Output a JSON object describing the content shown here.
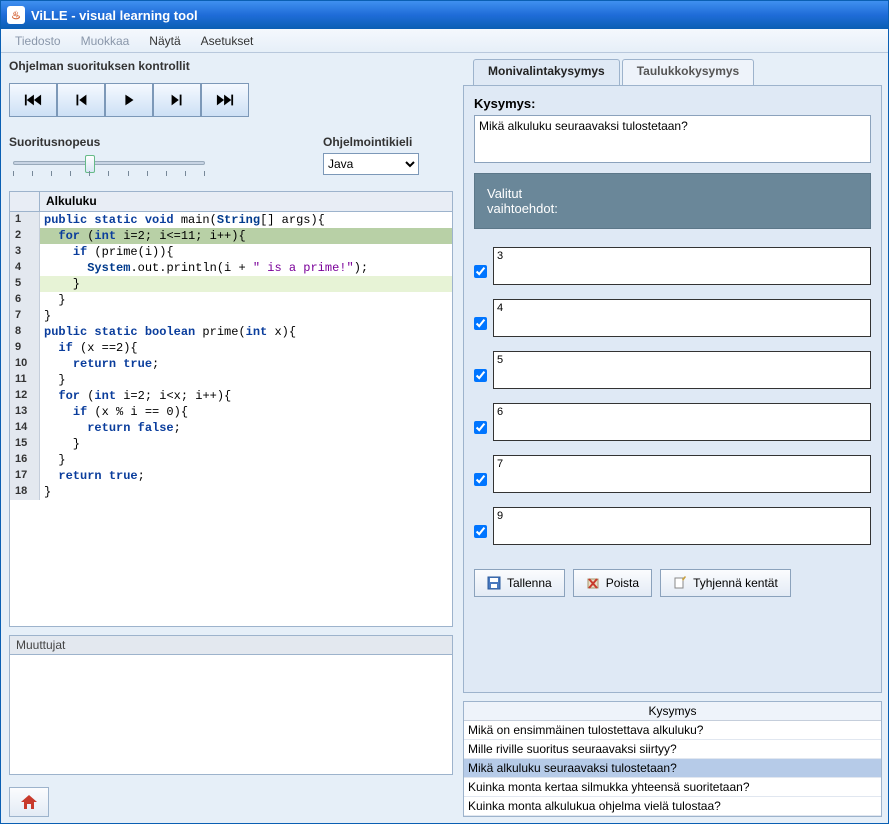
{
  "window": {
    "title": "ViLLE - visual learning tool"
  },
  "menu": {
    "tiedosto": "Tiedosto",
    "muokkaa": "Muokkaa",
    "nayta": "Näytä",
    "asetukset": "Asetukset"
  },
  "controls": {
    "title": "Ohjelman suorituksen kontrollit",
    "speed_label": "Suoritusnopeus",
    "lang_label": "Ohjelmointikieli",
    "lang_selected": "Java"
  },
  "code": {
    "title": "Alkuluku",
    "lines": [
      {
        "n": 1,
        "hl": "",
        "html": "<span class='kw-blue'>public static void</span> main(<span class='kw-class'>String</span>[] args){"
      },
      {
        "n": 2,
        "hl": "hl-green",
        "html": "  <span class='kw-blue'>for</span> (<span class='kw-blue'>int</span> i=2; i&lt;=11; i++){"
      },
      {
        "n": 3,
        "hl": "",
        "html": "    <span class='kw-blue'>if</span> (prime(i)){"
      },
      {
        "n": 4,
        "hl": "",
        "html": "      <span class='kw-class'>System</span>.out.println(i + <span class='kw-str'>\" is a prime!\"</span>);"
      },
      {
        "n": 5,
        "hl": "hl-light",
        "html": "    }"
      },
      {
        "n": 6,
        "hl": "",
        "html": "  }"
      },
      {
        "n": 7,
        "hl": "",
        "html": "}"
      },
      {
        "n": 8,
        "hl": "",
        "html": "<span class='kw-blue'>public static boolean</span> prime(<span class='kw-blue'>int</span> x){"
      },
      {
        "n": 9,
        "hl": "",
        "html": "  <span class='kw-blue'>if</span> (x ==2){"
      },
      {
        "n": 10,
        "hl": "",
        "html": "    <span class='kw-blue'>return true</span>;"
      },
      {
        "n": 11,
        "hl": "",
        "html": "  }"
      },
      {
        "n": 12,
        "hl": "",
        "html": "  <span class='kw-blue'>for</span> (<span class='kw-blue'>int</span> i=2; i&lt;x; i++){"
      },
      {
        "n": 13,
        "hl": "",
        "html": "    <span class='kw-blue'>if</span> (x % i == 0){"
      },
      {
        "n": 14,
        "hl": "",
        "html": "      <span class='kw-blue'>return false</span>;"
      },
      {
        "n": 15,
        "hl": "",
        "html": "    }"
      },
      {
        "n": 16,
        "hl": "",
        "html": "  }"
      },
      {
        "n": 17,
        "hl": "",
        "html": "  <span class='kw-blue'>return true</span>;"
      },
      {
        "n": 18,
        "hl": "",
        "html": "}"
      }
    ]
  },
  "vars": {
    "title": "Muuttujat"
  },
  "tabs": {
    "multi": "Monivalintakysymys",
    "table": "Taulukkokysymys"
  },
  "question": {
    "label": "Kysymys:",
    "text": "Mikä alkuluku seuraavaksi tulostetaan?",
    "choices_header_1": "Valitut",
    "choices_header_2": "vaihtoehdot:",
    "options": [
      {
        "checked": true,
        "value": "3"
      },
      {
        "checked": true,
        "value": "4"
      },
      {
        "checked": true,
        "value": "5"
      },
      {
        "checked": true,
        "value": "6"
      },
      {
        "checked": true,
        "value": "7"
      },
      {
        "checked": true,
        "value": "9"
      }
    ]
  },
  "buttons": {
    "save": "Tallenna",
    "delete": "Poista",
    "clear": "Tyhjennä kentät"
  },
  "question_list": {
    "header": "Kysymys",
    "items": [
      {
        "text": "Mikä on ensimmäinen tulostettava alkuluku?",
        "sel": false
      },
      {
        "text": "Mille riville suoritus seuraavaksi siirtyy?",
        "sel": false
      },
      {
        "text": "Mikä alkuluku seuraavaksi tulostetaan?",
        "sel": true
      },
      {
        "text": "Kuinka monta kertaa silmukka yhteensä suoritetaan?",
        "sel": false
      },
      {
        "text": "Kuinka monta alkulukua ohjelma vielä tulostaa?",
        "sel": false
      }
    ]
  }
}
